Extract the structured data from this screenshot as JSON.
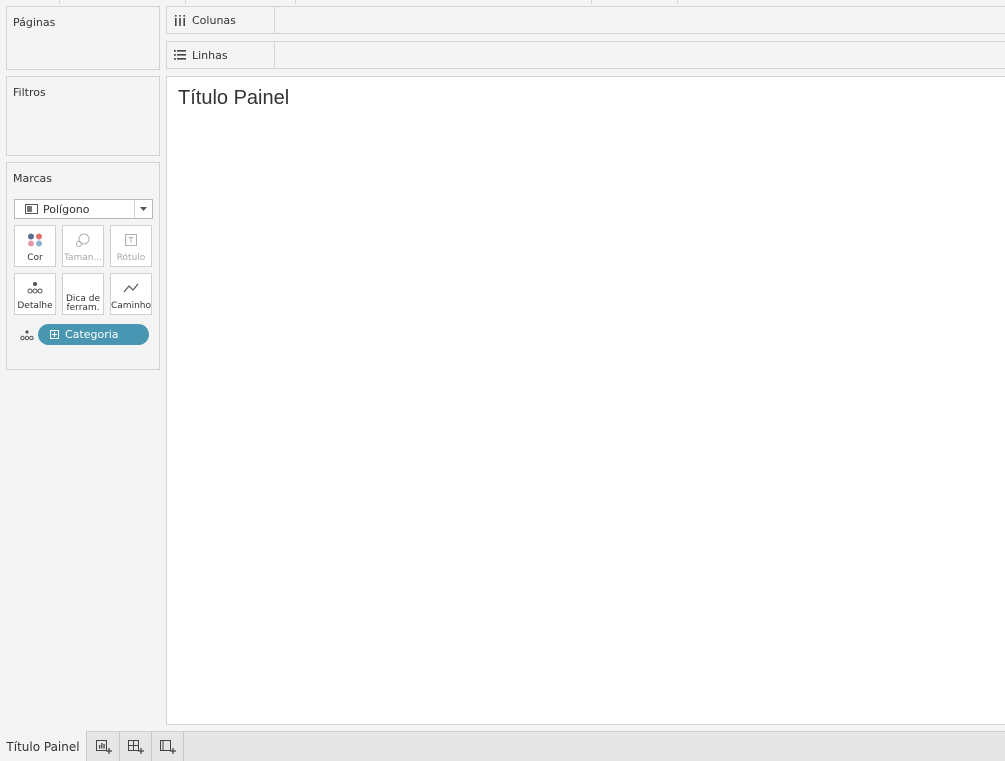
{
  "left_panel": {
    "pages_title": "Páginas",
    "filters_title": "Filtros",
    "marks_title": "Marcas",
    "mark_type": "Polígono",
    "buttons": {
      "color": "Cor",
      "size": "Taman...",
      "label": "Rótulo",
      "detail": "Detalhe",
      "tooltip_line1": "Dica de",
      "tooltip_line2": "ferram.",
      "path": "Caminho"
    },
    "field_pill": "Categoria"
  },
  "shelves": {
    "columns": "Colunas",
    "rows": "Linhas"
  },
  "canvas": {
    "title": "Título Painel"
  },
  "tabs": {
    "active": "Título Painel"
  },
  "colors": {
    "pill": "#4996b2",
    "background": "#f4f4f4",
    "border": "#d4d4d4"
  },
  "icons": {
    "columns": "columns-icon",
    "rows": "rows-icon",
    "polygon": "polygon-mark-icon",
    "new_sheet": "new-worksheet-icon",
    "new_dashboard": "new-dashboard-icon",
    "new_story": "new-story-icon"
  }
}
